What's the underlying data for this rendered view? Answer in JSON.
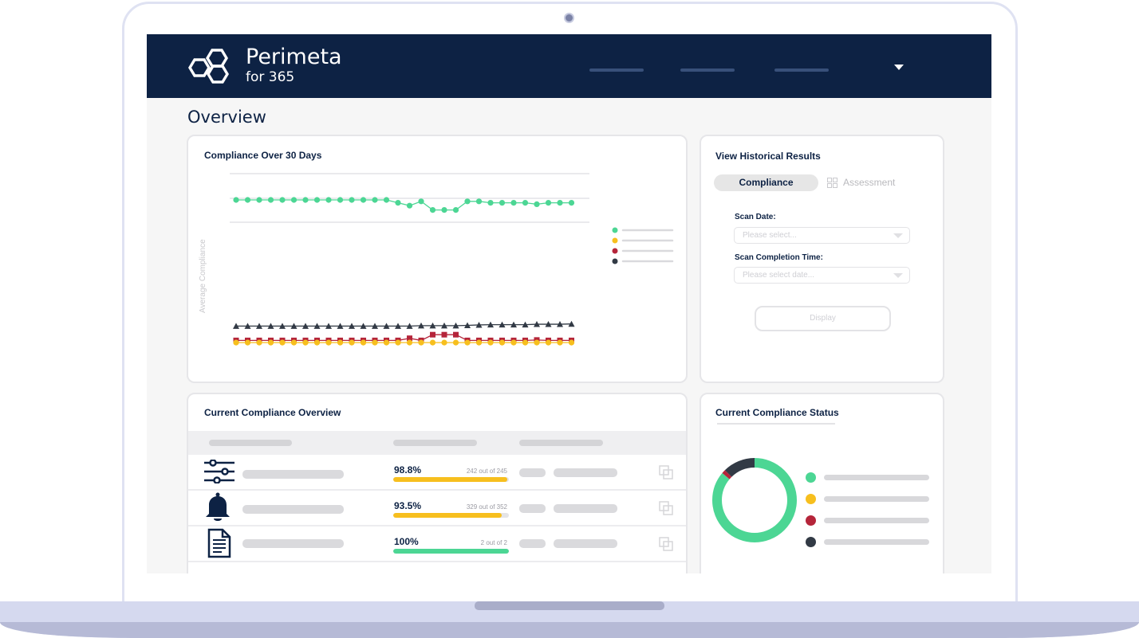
{
  "app": {
    "brand": "Perimeta",
    "brand_sub": "for 365",
    "page_title": "Overview",
    "user_menu_icon": "caret-down-icon"
  },
  "colors": {
    "navy": "#0d2244",
    "green": "#4cd694",
    "yellow": "#f7bf1e",
    "red": "#b5253a",
    "dark": "#323a45"
  },
  "compliance_chart": {
    "title": "Compliance Over 30 Days",
    "ylabel": "Average Compliance"
  },
  "chart_data": {
    "type": "line",
    "title": "Compliance Over 30 Days",
    "xlabel": "",
    "ylabel": "Average Compliance",
    "grid": true,
    "legend": "right",
    "series": [
      {
        "marker": "circle",
        "color": "#4cd694",
        "values": [
          100,
          100,
          100,
          100,
          100,
          100,
          100,
          100,
          100,
          100,
          100,
          100,
          100,
          100,
          98,
          96,
          99,
          93,
          93,
          93,
          99,
          99,
          98,
          98,
          98,
          98,
          97,
          98,
          98,
          98
        ]
      },
      {
        "marker": "triangle",
        "color": "#323a45",
        "values": [
          12,
          12,
          12,
          12,
          12,
          12,
          12,
          12,
          12,
          12,
          12,
          12,
          12,
          12,
          12,
          12,
          12.3,
          12.3,
          12.3,
          12.3,
          12.5,
          12.8,
          13,
          13,
          13,
          13,
          13.3,
          13.3,
          13.3,
          13.5
        ]
      },
      {
        "marker": "square",
        "color": "#b5253a",
        "values": [
          2,
          2,
          2,
          2,
          2,
          2,
          2,
          2,
          2,
          2,
          2,
          2,
          2,
          2,
          2,
          3.5,
          2,
          6,
          6,
          6,
          2,
          2,
          2,
          2,
          2,
          2,
          2.3,
          2,
          2,
          2
        ]
      },
      {
        "marker": "circle",
        "color": "#f7bf1e",
        "values": [
          0.5,
          0.5,
          0.5,
          0.5,
          0.5,
          0.5,
          0.5,
          0.5,
          0.5,
          0.5,
          0.5,
          0.5,
          0.5,
          0.5,
          0.5,
          0.5,
          0.5,
          0.5,
          0.5,
          0.5,
          0.5,
          0.5,
          0.5,
          0.5,
          0.5,
          0.5,
          0.5,
          0.5,
          0.5,
          0.5
        ]
      }
    ]
  },
  "historical": {
    "title": "View Historical Results",
    "tab_compliance": "Compliance",
    "tab_assessment": "Assessment",
    "scan_date_label": "Scan Date:",
    "scan_date_placeholder": "Please select...",
    "scan_time_label": "Scan Completion Time:",
    "scan_time_placeholder": "Please select date...",
    "display_button": "Display"
  },
  "overview": {
    "title": "Current Compliance Overview",
    "rows": [
      {
        "icon": "sliders-icon",
        "percent": "98.8%",
        "count": "242 out of 245",
        "fraction": 0.988,
        "color": "#f7bf1e"
      },
      {
        "icon": "bell-icon",
        "percent": "93.5%",
        "count": "329 out of 352",
        "fraction": 0.935,
        "color": "#f7bf1e"
      },
      {
        "icon": "document-icon",
        "percent": "100%",
        "count": "2 out of 2",
        "fraction": 1.0,
        "color": "#4cd694"
      }
    ]
  },
  "status": {
    "title": "Current Compliance Status",
    "donut_fractions": [
      0.86,
      0.0,
      0.015,
      0.125
    ]
  }
}
